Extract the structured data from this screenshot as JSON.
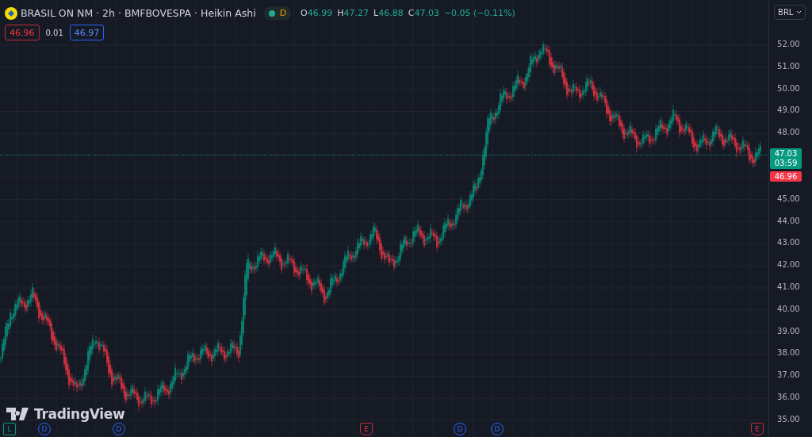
{
  "header": {
    "title": "BRASIL ON NM · 2h · BMFBOVESPA · Heikin Ashi",
    "status_letter": "D",
    "ohlc": [
      {
        "label": "O",
        "value": "46.99"
      },
      {
        "label": "H",
        "value": "47.27"
      },
      {
        "label": "L",
        "value": "46.88"
      },
      {
        "label": "C",
        "value": "47.03"
      }
    ],
    "change": "−0.05 (−0.11%)"
  },
  "trade": {
    "sell": "46.96",
    "spread": "0.01",
    "buy": "46.97"
  },
  "currency": "BRL",
  "price_axis": [
    "52.00",
    "51.00",
    "50.00",
    "49.00",
    "48.00",
    "45.00",
    "44.00",
    "43.00",
    "42.00",
    "41.00",
    "40.00",
    "39.00",
    "38.00",
    "37.00",
    "36.00",
    "35.00"
  ],
  "last_price": {
    "price": "47.03",
    "countdown": "03:59"
  },
  "bid_price": "46.96",
  "events": [
    {
      "kind": "split",
      "letter": "L"
    },
    {
      "kind": "dividend",
      "letter": "D"
    },
    {
      "kind": "dividend",
      "letter": "D"
    },
    {
      "kind": "earnings",
      "letter": "E"
    },
    {
      "kind": "dividend",
      "letter": "D"
    },
    {
      "kind": "dividend",
      "letter": "D"
    },
    {
      "kind": "earnings",
      "letter": "E"
    }
  ],
  "brand": "TradingView"
}
